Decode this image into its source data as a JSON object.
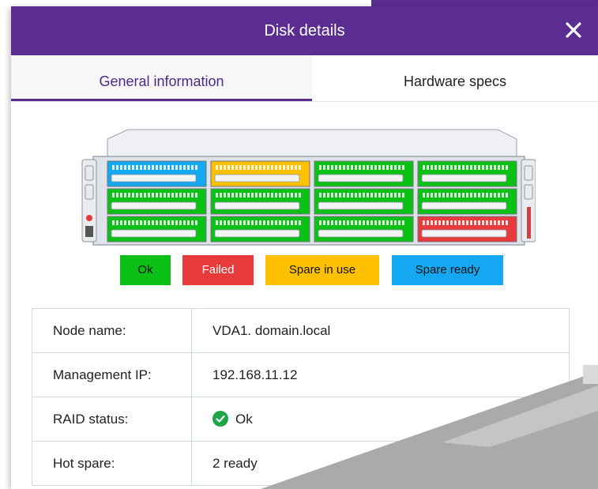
{
  "dialog": {
    "title": "Disk details",
    "close_icon": "close-icon"
  },
  "tabs": [
    {
      "label": "General information",
      "active": true
    },
    {
      "label": "Hardware specs",
      "active": false
    }
  ],
  "server": {
    "bays": [
      [
        "spare-ready",
        "spare-in-use",
        "ok",
        "ok"
      ],
      [
        "ok",
        "ok",
        "ok",
        "ok"
      ],
      [
        "ok",
        "ok",
        "ok",
        "failed"
      ]
    ]
  },
  "legend": [
    {
      "label": "Ok",
      "color": "#0bc115"
    },
    {
      "label": "Failed",
      "color": "#e83a3a"
    },
    {
      "label": "Spare in use",
      "color": "#ffc000"
    },
    {
      "label": "Spare ready",
      "color": "#14a7f2"
    }
  ],
  "info": {
    "rows": [
      {
        "label": "Node name:",
        "value": "VDA1. domain.local"
      },
      {
        "label": "Management IP:",
        "value": "192.168.11.12"
      },
      {
        "label": "RAID status:",
        "value": "Ok",
        "icon": "check-circle-icon"
      },
      {
        "label": "Hot spare:",
        "value": "2 ready"
      }
    ]
  },
  "colors": {
    "accent": "#5b2d90",
    "ok": "#0bc115",
    "failed": "#e83a3a",
    "spare_in_use": "#ffc000",
    "spare_ready": "#14a7f2"
  }
}
